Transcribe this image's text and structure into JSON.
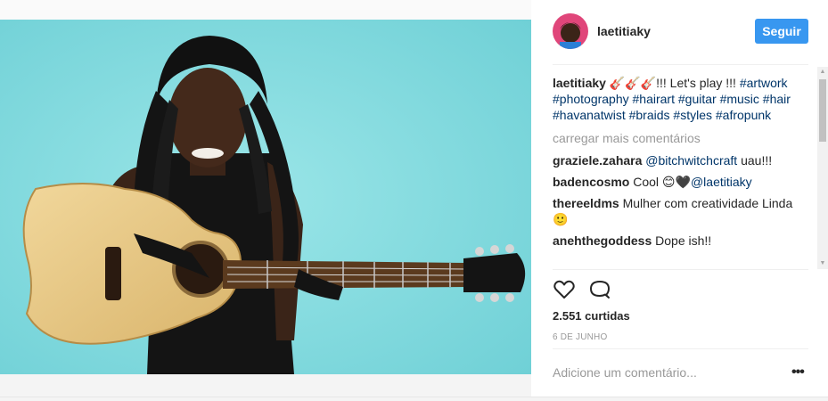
{
  "post": {
    "username": "laetitiaky",
    "follow_label": "Seguir",
    "caption_user": "laetitiaky",
    "caption_text": "🎸🎸🎸!!! Let's play !!!",
    "caption_tags": "#artwork #photography #hairart #guitar #music #hair #havanatwist #braids #styles #afropunk",
    "load_more": "carregar mais comentários",
    "comments": [
      {
        "user": "graziele.zahara",
        "mention": "@bitchwitchcraft",
        "text": " uau!!!"
      },
      {
        "user": "badencosmo",
        "text": " Cool 😊🖤",
        "mention": "@laetitiaky"
      },
      {
        "user": "thereeldms",
        "text": " Mulher com creatividade Linda 🙂"
      },
      {
        "user": "anehthegoddess",
        "text": " Dope ish!!"
      }
    ],
    "likes": "2.551 curtidas",
    "date": "6 DE JUNHO",
    "add_comment_placeholder": "Adicione um comentário...",
    "more_options": "•••"
  },
  "icons": {
    "like": "heart-icon",
    "comment": "comment-icon",
    "scroll_up": "scroll-up-arrow",
    "scroll_down": "scroll-down-arrow"
  },
  "colors": {
    "follow_button": "#3897f0",
    "hashtag": "#003569",
    "photo_background": "#86dde0"
  }
}
